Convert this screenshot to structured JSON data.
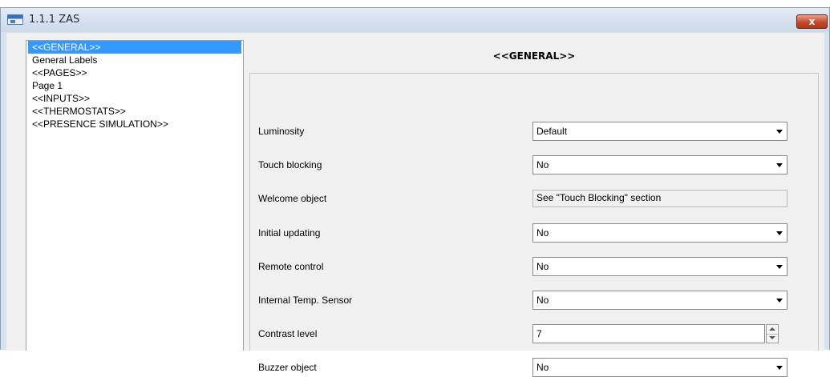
{
  "window": {
    "title": "1.1.1 ZAS",
    "close_label": "x"
  },
  "tree": {
    "items": [
      {
        "label": "<<GENERAL>>",
        "selected": true
      },
      {
        "label": "General Labels"
      },
      {
        "label": "<<PAGES>>"
      },
      {
        "label": "Page 1"
      },
      {
        "label": "<<INPUTS>>"
      },
      {
        "label": "<<THERMOSTATS>>"
      },
      {
        "label": "<<PRESENCE SIMULATION>>"
      }
    ]
  },
  "panel": {
    "title": "<<GENERAL>>",
    "fields": [
      {
        "label": "Luminosity",
        "type": "dropdown",
        "value": "Default"
      },
      {
        "label": "Touch blocking",
        "type": "dropdown",
        "value": "No"
      },
      {
        "label": "Welcome object",
        "type": "readonly",
        "value": "See \"Touch Blocking\" section"
      },
      {
        "label": "Initial updating",
        "type": "dropdown",
        "value": "No"
      },
      {
        "label": "Remote control",
        "type": "dropdown",
        "value": "No"
      },
      {
        "label": "Internal Temp. Sensor",
        "type": "dropdown",
        "value": "No"
      },
      {
        "label": "Contrast level",
        "type": "spinner",
        "value": "7"
      },
      {
        "label": "Buzzer object",
        "type": "dropdown",
        "value": "No"
      }
    ]
  }
}
